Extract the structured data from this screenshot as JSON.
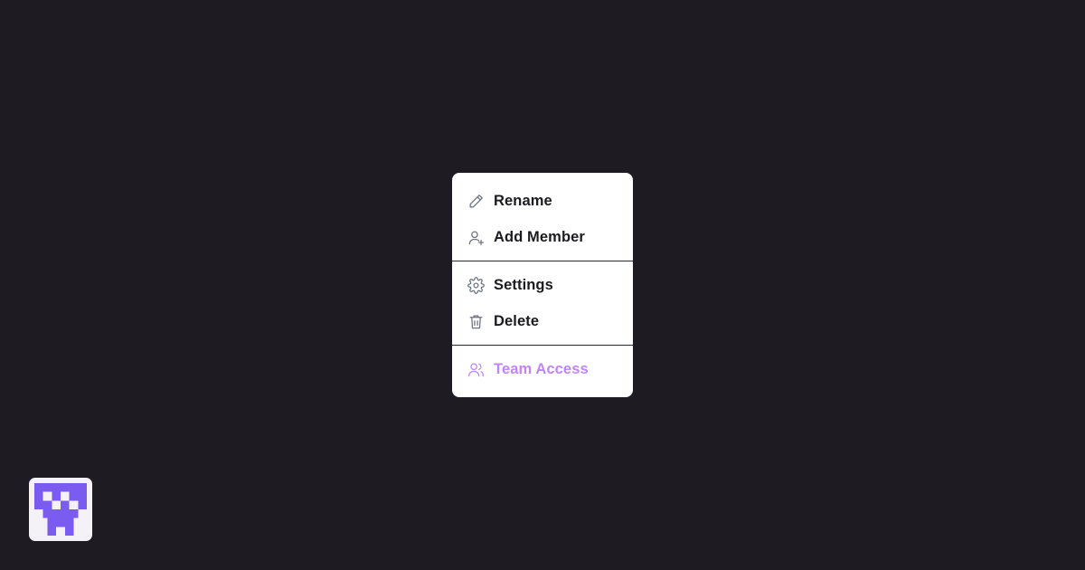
{
  "menu": {
    "items": [
      {
        "label": "Rename",
        "icon": "pencil-icon"
      },
      {
        "label": "Add Member",
        "icon": "user-plus-icon"
      },
      {
        "label": "Settings",
        "icon": "gear-icon"
      },
      {
        "label": "Delete",
        "icon": "trash-icon"
      },
      {
        "label": "Team Access",
        "icon": "users-icon"
      }
    ]
  },
  "colors": {
    "background": "#1e1b22",
    "menu_bg": "#ffffff",
    "text": "#1b1b1f",
    "icon": "#6b7280",
    "accent": "#c084fc",
    "logo_purple": "#7b5cf0"
  }
}
